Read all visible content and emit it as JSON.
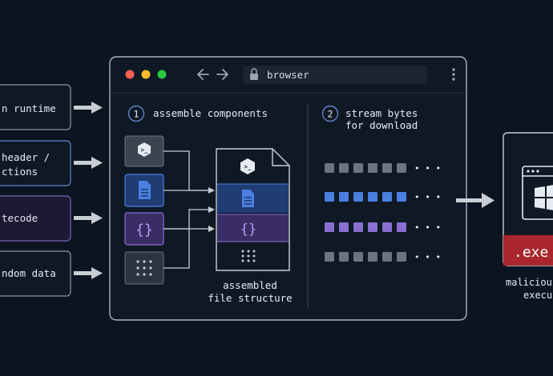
{
  "inputs": [
    {
      "lines": [
        "n runtime"
      ],
      "color": "#0f1925",
      "stroke": "#8d97a3"
    },
    {
      "lines": [
        "header /",
        "ctions"
      ],
      "color": "#0f1925",
      "stroke": "#5f86c8"
    },
    {
      "lines": [
        "tecode"
      ],
      "color": "#1d1833",
      "stroke": "#7a66b8"
    },
    {
      "lines": [
        "ndom data"
      ],
      "color": "#0f1925",
      "stroke": "#8d97a3"
    }
  ],
  "browser": {
    "address": "browser",
    "step1": {
      "number": "1",
      "label": "assemble components"
    },
    "step2": {
      "number": "2",
      "lines": [
        "stream bytes",
        "for download"
      ]
    },
    "components": [
      {
        "icon": "terminal-icon",
        "glyph": ">_",
        "color": "#3b4552"
      },
      {
        "icon": "document-icon",
        "glyph": "",
        "color": "#1f3d73"
      },
      {
        "icon": "braces-icon",
        "glyph": "{}",
        "color": "#3a2d66"
      },
      {
        "icon": "dots-grid-icon",
        "glyph": "",
        "color": "#2b3440"
      }
    ],
    "assembled_caption": [
      "assembled",
      "file structure"
    ],
    "streams": [
      {
        "color": "#6b7480",
        "ellipsis": "• • •"
      },
      {
        "color": "#4a7fe0",
        "ellipsis": "• • •"
      },
      {
        "color": "#8a6fd0",
        "ellipsis": "• • •"
      },
      {
        "color": "#6b7480",
        "ellipsis": "• • •"
      }
    ]
  },
  "output": {
    "badge": ".exe",
    "caption": [
      "malicious",
      "execu"
    ]
  },
  "colors": {
    "background": "#0b1420",
    "panel": "#0f1925",
    "border": "#aab4bf",
    "arrow": "#c9ced4",
    "exe_red": "#a8262c",
    "dot_red": "#ff5f57",
    "dot_yellow": "#febc2e",
    "dot_green": "#28c840"
  }
}
